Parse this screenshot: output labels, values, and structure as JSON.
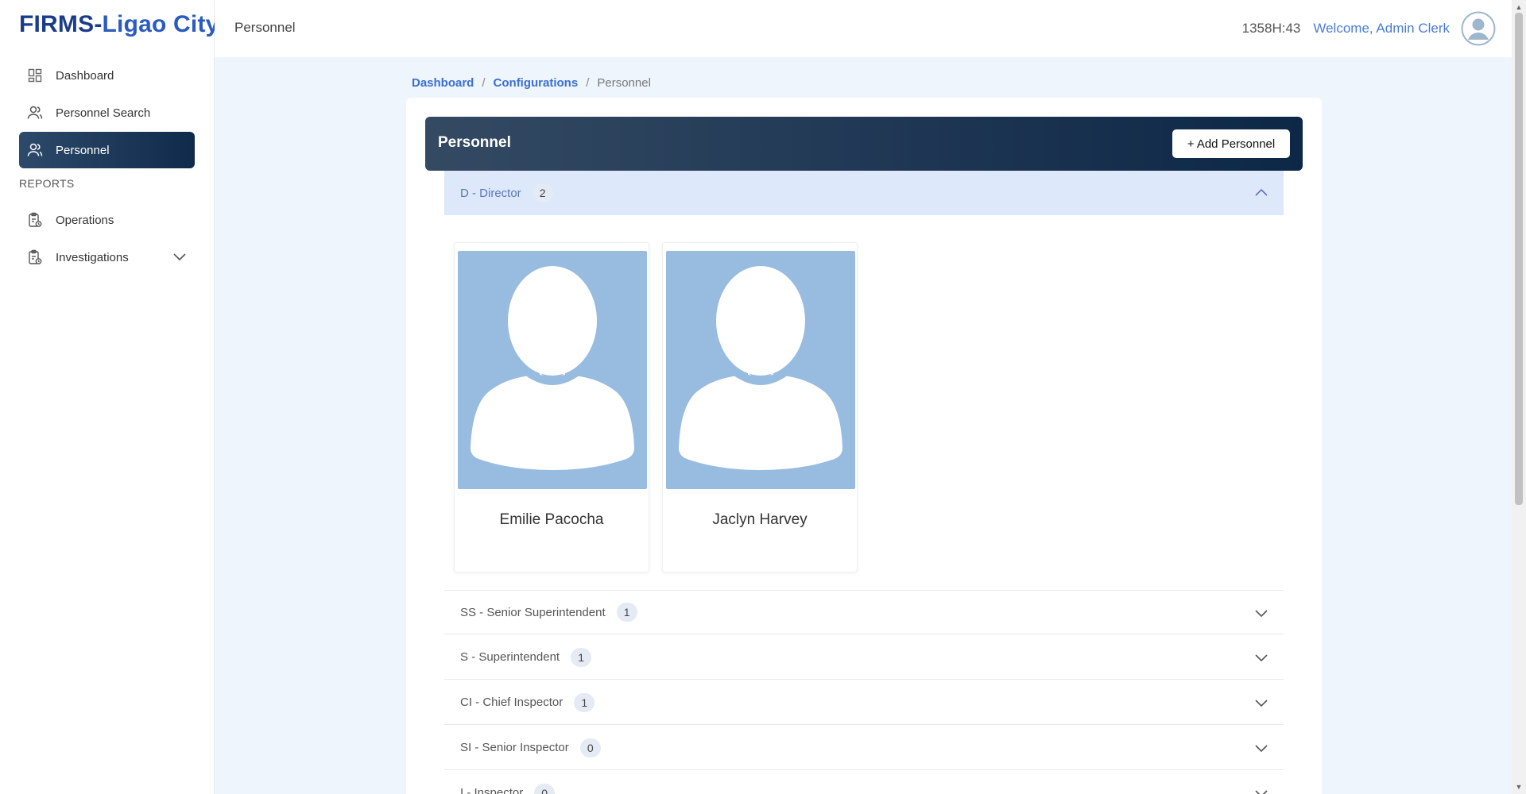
{
  "brand": {
    "prefix": "FIRMS-",
    "city": "Ligao City"
  },
  "sidebar": {
    "items": [
      {
        "label": "Dashboard",
        "icon": "dashboard-icon"
      },
      {
        "label": "Personnel Search",
        "icon": "users-icon"
      },
      {
        "label": "Personnel",
        "icon": "users-icon",
        "active": true
      }
    ],
    "section_label": "REPORTS",
    "report_items": [
      {
        "label": "Operations",
        "icon": "clipboard-icon"
      },
      {
        "label": "Investigations",
        "icon": "clipboard-icon",
        "expandable": true
      }
    ]
  },
  "header": {
    "page_title": "Personnel",
    "timer": "1358H:43",
    "welcome": "Welcome, Admin Clerk"
  },
  "breadcrumb": {
    "items": [
      "Dashboard",
      "Configurations",
      "Personnel"
    ],
    "separator": "/"
  },
  "panel": {
    "title": "Personnel",
    "add_button": "+ Add Personnel"
  },
  "groups": [
    {
      "label": "D - Director",
      "count": "2",
      "expanded": true
    },
    {
      "label": "SS - Senior Superintendent",
      "count": "1",
      "expanded": false
    },
    {
      "label": "S - Superintendent",
      "count": "1",
      "expanded": false
    },
    {
      "label": "CI - Chief Inspector",
      "count": "1",
      "expanded": false
    },
    {
      "label": "SI - Senior Inspector",
      "count": "0",
      "expanded": false
    },
    {
      "label": "I - Inspector",
      "count": "0",
      "expanded": false
    }
  ],
  "personnel_cards": [
    {
      "name": "Emilie Pacocha"
    },
    {
      "name": "Jaclyn Harvey"
    }
  ],
  "colors": {
    "brand": "#1a3c8a",
    "accent": "#4a7cd8",
    "active_nav": "#0f2a4a",
    "group_open_bg": "#dde8fb",
    "photo_bg": "#98bbe0"
  }
}
